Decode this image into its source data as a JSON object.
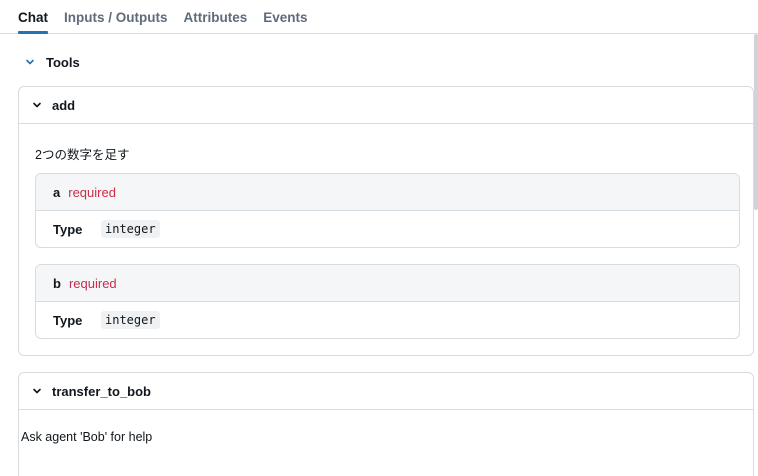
{
  "tabs": [
    {
      "label": "Chat",
      "active": true
    },
    {
      "label": "Inputs / Outputs",
      "active": false
    },
    {
      "label": "Attributes",
      "active": false
    },
    {
      "label": "Events",
      "active": false
    }
  ],
  "section": {
    "title": "Tools",
    "icon": "chevron-down-icon"
  },
  "tools": [
    {
      "name": "add",
      "description": "2つの数字を足す",
      "parameters": [
        {
          "name": "a",
          "required_label": "required",
          "type_label": "Type",
          "type_value": "integer"
        },
        {
          "name": "b",
          "required_label": "required",
          "type_label": "Type",
          "type_value": "integer"
        }
      ]
    },
    {
      "name": "transfer_to_bob",
      "description": "Ask agent 'Bob' for help"
    }
  ],
  "colors": {
    "accent": "#2272b4",
    "required": "#c82d4c",
    "border": "#d7dce1",
    "param_header_bg": "#f5f6f7"
  }
}
